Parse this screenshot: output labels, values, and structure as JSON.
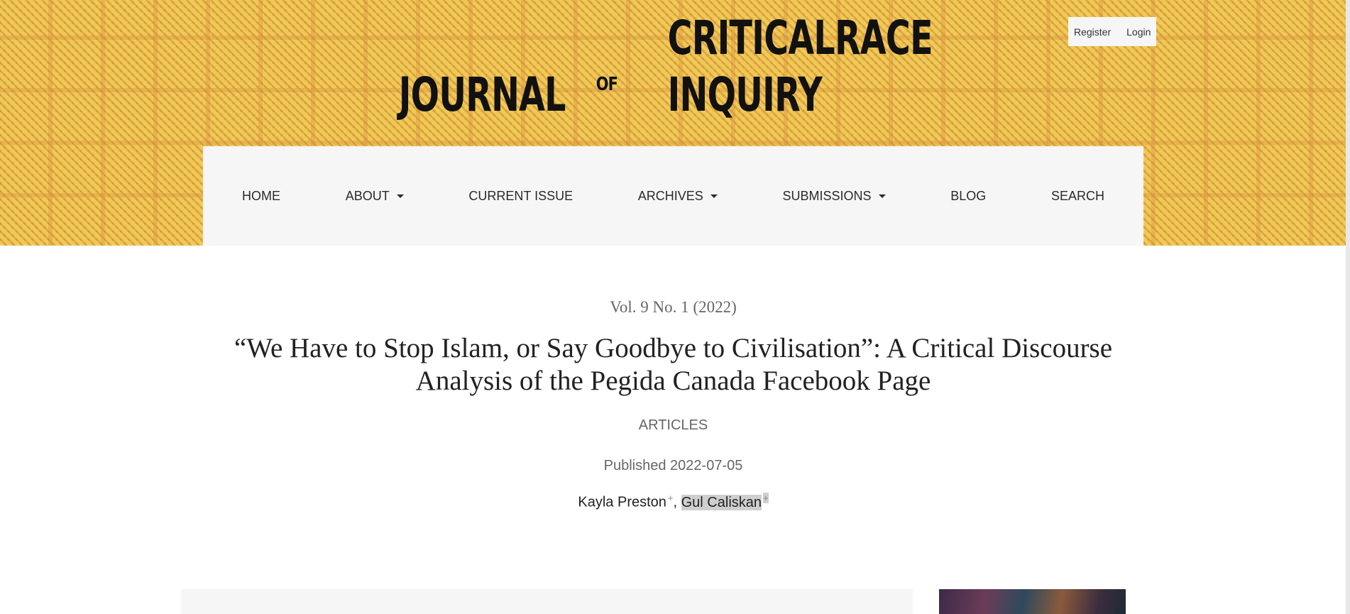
{
  "header": {
    "user_nav": {
      "register": "Register",
      "login": "Login"
    },
    "logo": {
      "part1": "JOURNAL",
      "part2": "OF",
      "part3": "CRITICALRACE INQUIRY"
    },
    "nav": [
      {
        "label": "HOME",
        "has_dropdown": false
      },
      {
        "label": "ABOUT",
        "has_dropdown": true
      },
      {
        "label": "CURRENT ISSUE",
        "has_dropdown": false
      },
      {
        "label": "ARCHIVES",
        "has_dropdown": true
      },
      {
        "label": "SUBMISSIONS",
        "has_dropdown": true
      },
      {
        "label": "BLOG",
        "has_dropdown": false
      },
      {
        "label": "SEARCH",
        "has_dropdown": false
      }
    ]
  },
  "article": {
    "issue": "Vol. 9 No. 1 (2022)",
    "title": "“We Have to Stop Islam, or Say Goodbye to Civilisation”: A Critical Discourse Analysis of the Pegida Canada Facebook Page",
    "section": "ARTICLES",
    "published": "Published 2022-07-05",
    "authors": [
      {
        "name": "Kayla Preston",
        "mark": "+"
      },
      {
        "name": "Gul Caliskan",
        "mark": "+"
      }
    ],
    "author_separator": ","
  },
  "colors": {
    "header_bg": "#e9b64a",
    "nav_bg": "#f6f6f6",
    "text": "#222222",
    "muted": "#666666"
  }
}
